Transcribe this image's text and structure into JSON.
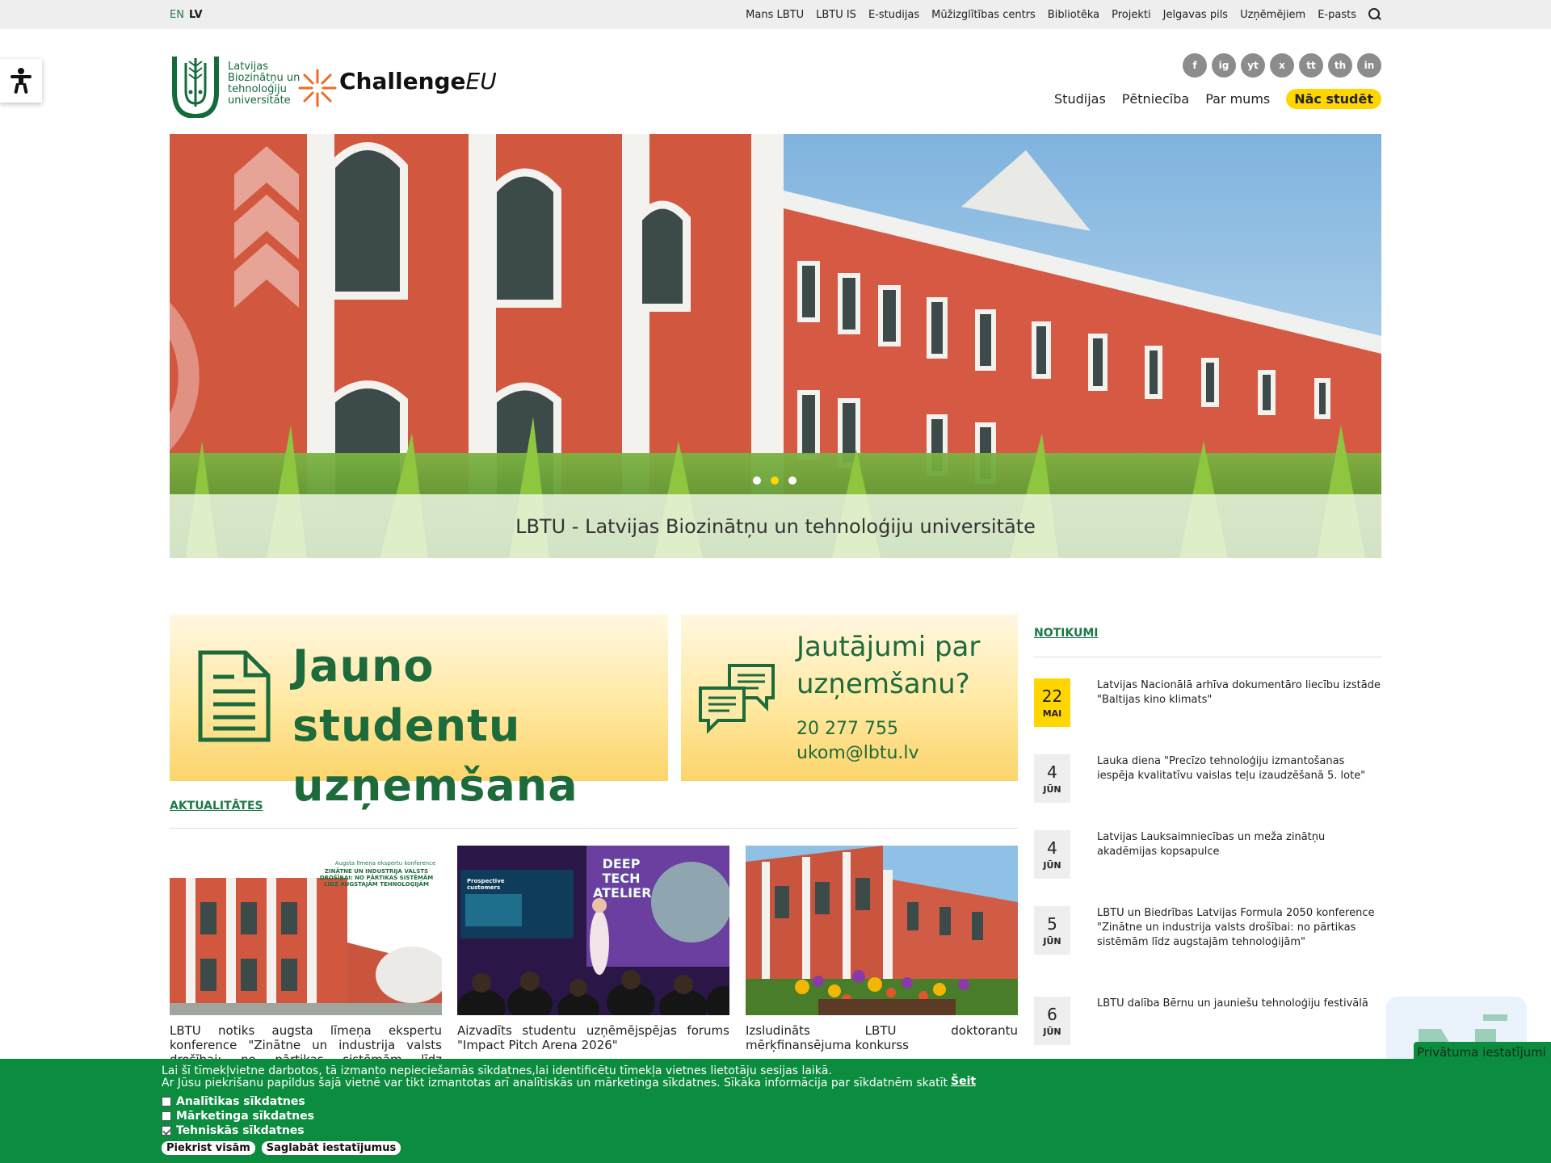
{
  "topbar": {
    "languages": [
      "EN",
      "LV"
    ],
    "links": [
      "Mans LBTU",
      "LBTU IS",
      "E-studijas",
      "Mūžizglītības centrs",
      "Bibliotēka",
      "Projekti",
      "Jelgavas pils",
      "Uzņēmējiem",
      "E-pasts"
    ]
  },
  "logo": {
    "university_lines": [
      "Latvijas",
      "Biozinātņu un",
      "tehnoloģiju",
      "universitāte"
    ],
    "challenge_main": "Challenge",
    "challenge_suffix": "EU"
  },
  "socials": [
    "f",
    "ig",
    "yt",
    "x",
    "tt",
    "th",
    "in"
  ],
  "nav": {
    "items": [
      "Studijas",
      "Pētniecība",
      "Par mums"
    ],
    "highlight": "Nāc studēt"
  },
  "hero": {
    "caption": "LBTU - Latvijas Biozinātņu un tehnoloģiju universitāte",
    "active_slide": 2,
    "slide_count": 3
  },
  "banners": {
    "admission": {
      "line1": "Jauno studentu",
      "line2": "uzņemšana"
    },
    "questions": {
      "line1": "Jautājumi par",
      "line2": "uzņemšanu?",
      "phone": "20 277 755",
      "email": "ukom@lbtu.lv"
    }
  },
  "news": {
    "heading": "AKTUALITĀTES",
    "items": [
      {
        "title": "LBTU notiks augsta līmeņa ekspertu konference \"Zinātne un industrija valsts drošībai: no pārtikas sistēmām līdz augstajām tehnoloģijām\"",
        "poster_small": "Augsta līmeņa ekspertu konference",
        "poster_main": "ZINĀTNE UN INDUSTRIJA VALSTS DROŠĪBAI: NO PĀRTIKAS SISTĒMĀM LĪDZ AUGSTAJĀM TEHNOLOĢIJĀM"
      },
      {
        "title": "Aizvadīts studentu uzņēmējspējas forums \"Impact Pitch Arena 2026\"",
        "screen_text": "Prospective customers",
        "poster_text": "DEEP TECH ATELIER"
      },
      {
        "title": "Izsludināts LBTU doktorantu mērķfinansējuma konkurss"
      }
    ]
  },
  "events": {
    "heading": "NOTIKUMI",
    "items": [
      {
        "day": "22",
        "month": "MAI",
        "title": "Latvijas Nacionālā arhīva dokumentāro liecību izstāde \"Baltijas kino klimats\""
      },
      {
        "day": "4",
        "month": "JŪN",
        "title": "Lauka diena \"Precīzo tehnoloģiju izmantošanas iespēja kvalitatīvu vaislas teļu izaudzēšanā 5. lote\""
      },
      {
        "day": "4",
        "month": "JŪN",
        "title": "Latvijas Lauksaimniecības un meža zinātņu akadēmijas kopsapulce"
      },
      {
        "day": "5",
        "month": "JŪN",
        "title": "LBTU un Biedrības Latvijas Formula 2050 konference \"Zinātne un industrija valsts drošībai: no pārtikas sistēmām līdz augstajām tehnoloģijām\""
      },
      {
        "day": "6",
        "month": "JŪN",
        "title": "LBTU dalība Bērnu un jauniešu tehnoloģiju festivālā"
      }
    ]
  },
  "cookie": {
    "line1": "Lai šī tīmekļvietne darbotos, tā izmanto nepieciešamās sīkdatnes,lai identificētu tīmekļa vietnes lietotāju sesijas laikā.",
    "line2": "Ar Jūsu piekrišanu papildus šajā vietnē var tikt izmantotas arī analītiskās un mārketinga sīkdatnes. Sīkāka informācija par sīkdatnēm skatīt",
    "link": "Šeit",
    "options": [
      {
        "label": "Analītikas sīkdatnes",
        "checked": false
      },
      {
        "label": "Mārketinga sīkdatnes",
        "checked": false
      },
      {
        "label": "Tehniskās sīkdatnes",
        "checked": true
      }
    ],
    "accept_all": "Piekrist visām",
    "save": "Saglabāt iestatījumus"
  },
  "privacy_button": "Privātuma iestatījumi",
  "colors": {
    "brand_green": "#1d6b3b",
    "accent_yellow": "#ffd600",
    "cookie_green": "#0c8c3e"
  }
}
